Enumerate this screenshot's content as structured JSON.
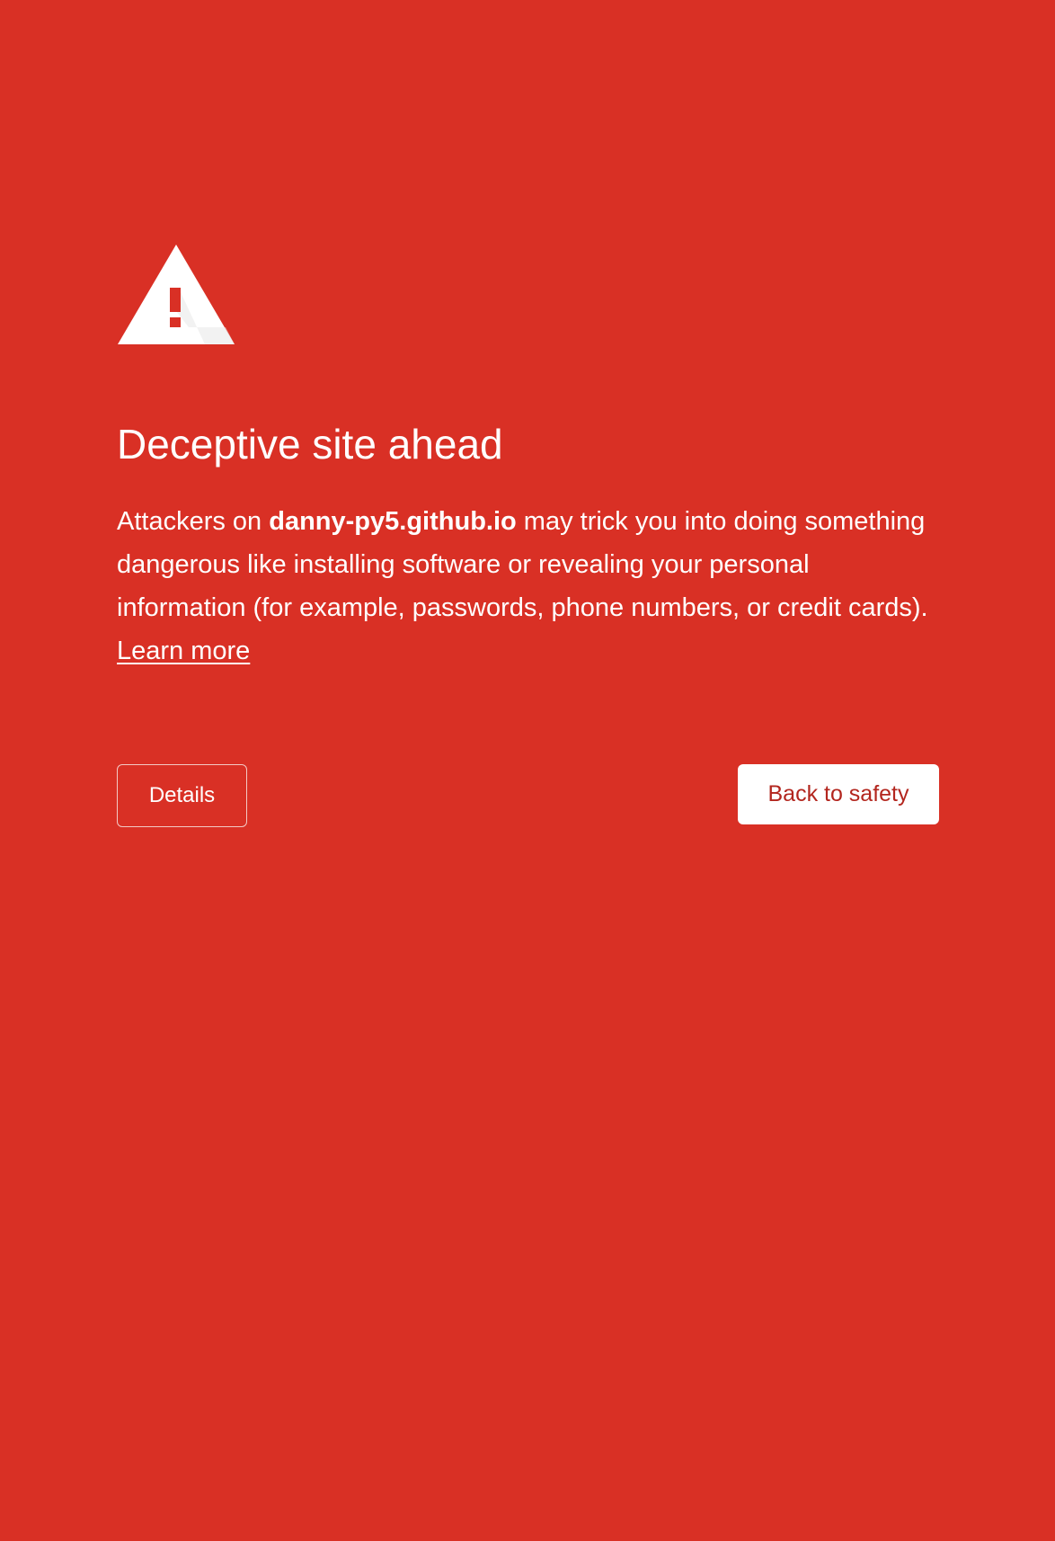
{
  "theme": {
    "background": "#d93025",
    "text": "#ffffff",
    "primary_button_text": "#b3261e"
  },
  "icon": {
    "name": "warning-triangle-icon"
  },
  "interstitial": {
    "title": "Deceptive site ahead",
    "description_prefix": "Attackers on ",
    "site": "danny-py5.github.io",
    "description_suffix": " may trick you into doing something dangerous like installing software or revealing your personal information (for example, passwords, phone numbers, or credit cards). ",
    "learn_more_label": "Learn more"
  },
  "buttons": {
    "details_label": "Details",
    "back_to_safety_label": "Back to safety"
  }
}
